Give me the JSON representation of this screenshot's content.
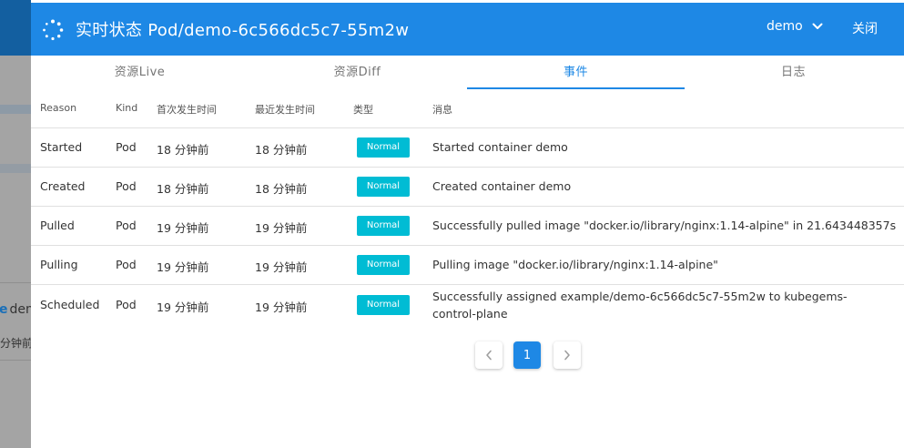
{
  "background": {
    "row_text": "dem",
    "time_text": "分钟前"
  },
  "dialog": {
    "title": "实时状态 Pod/demo-6c566dc5c7-55m2w",
    "namespace": "demo",
    "close_label": "关闭",
    "tabs": [
      {
        "label": "资源Live",
        "active": false
      },
      {
        "label": "资源Diff",
        "active": false
      },
      {
        "label": "事件",
        "active": true
      },
      {
        "label": "日志",
        "active": false
      }
    ],
    "table": {
      "headers": [
        "Reason",
        "Kind",
        "首次发生时间",
        "最近发生时间",
        "类型",
        "消息"
      ],
      "rows": [
        {
          "reason": "Started",
          "kind": "Pod",
          "first": "18 分钟前",
          "last": "18 分钟前",
          "type": "Normal",
          "message": "Started container demo"
        },
        {
          "reason": "Created",
          "kind": "Pod",
          "first": "18 分钟前",
          "last": "18 分钟前",
          "type": "Normal",
          "message": "Created container demo"
        },
        {
          "reason": "Pulled",
          "kind": "Pod",
          "first": "19 分钟前",
          "last": "19 分钟前",
          "type": "Normal",
          "message": "Successfully pulled image \"docker.io/library/nginx:1.14-alpine\" in 21.643448357s"
        },
        {
          "reason": "Pulling",
          "kind": "Pod",
          "first": "19 分钟前",
          "last": "19 分钟前",
          "type": "Normal",
          "message": "Pulling image \"docker.io/library/nginx:1.14-alpine\""
        },
        {
          "reason": "Scheduled",
          "kind": "Pod",
          "first": "19 分钟前",
          "last": "19 分钟前",
          "type": "Normal",
          "message": "Successfully assigned example/demo-6c566dc5c7-55m2w to kubegems-control-plane"
        }
      ]
    },
    "pagination": {
      "current_page": "1"
    }
  },
  "colors": {
    "primary": "#1e88e5",
    "badge": "#00bcd4"
  }
}
